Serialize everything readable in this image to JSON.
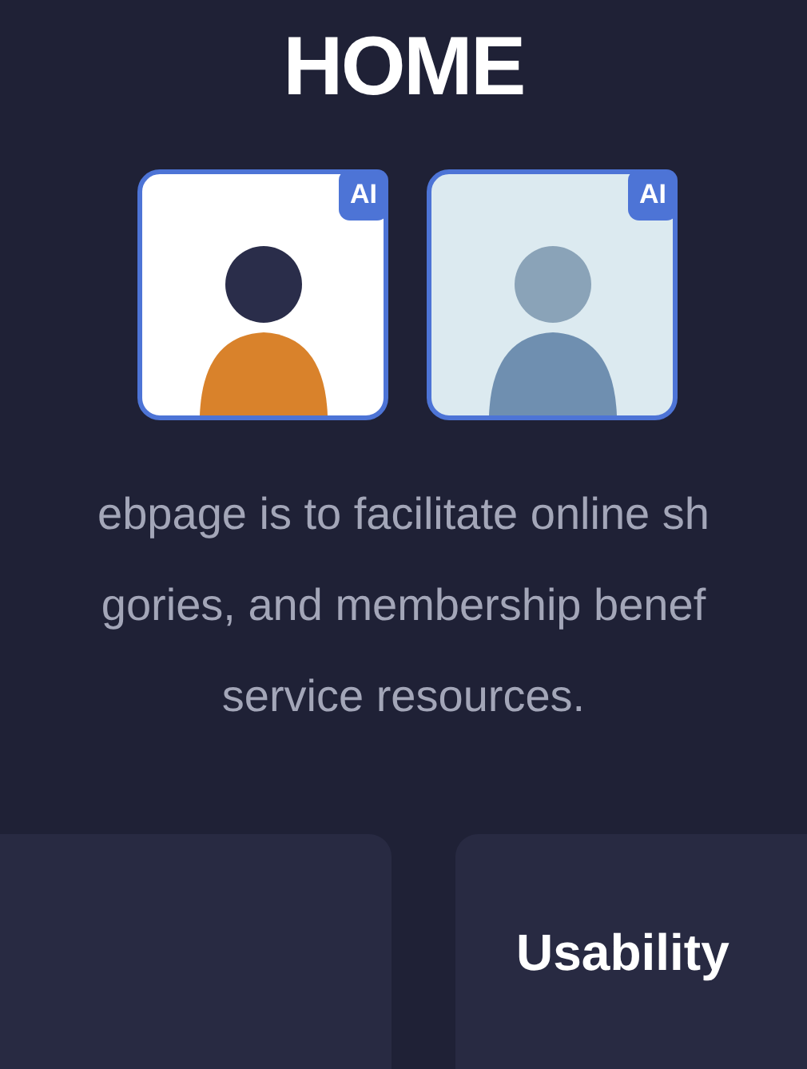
{
  "title": "HOME",
  "avatars": [
    {
      "badge": "AI",
      "kind": "woman"
    },
    {
      "badge": "AI",
      "kind": "man"
    }
  ],
  "description_lines": [
    "ebpage is to facilitate online sh",
    "gories, and membership benef",
    "service resources."
  ],
  "cards": [
    {
      "kind": "blank"
    },
    {
      "kind": "titled",
      "title": "Usability"
    }
  ]
}
